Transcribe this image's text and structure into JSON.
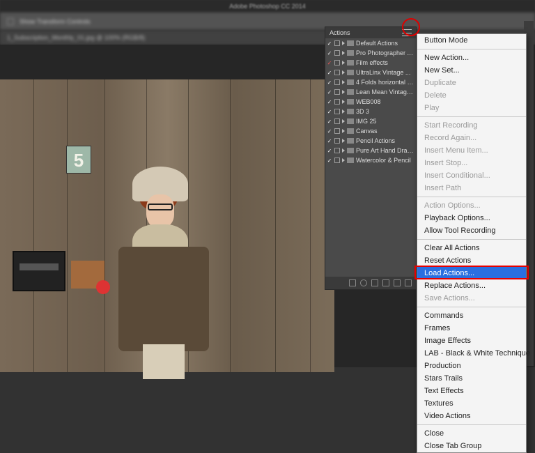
{
  "app": {
    "title": "Adobe Photoshop CC 2014"
  },
  "options_bar": {
    "show_transform_label": "Show Transform Controls"
  },
  "document_tab": {
    "label": "1_Subscription_Monthly_01.jpg @ 100% (RGB/8)"
  },
  "canvas": {
    "plate_number": "5"
  },
  "actions_panel": {
    "title": "Actions",
    "sets": [
      {
        "name": "Default Actions",
        "checked": true
      },
      {
        "name": "Pro Photographer A...",
        "checked": true
      },
      {
        "name": "Film effects",
        "checked": true,
        "redcheck": true
      },
      {
        "name": "UltraLinx Vintage ...",
        "checked": true
      },
      {
        "name": "4 Folds horizontal v...",
        "checked": true
      },
      {
        "name": "Lean Mean Vintage ...",
        "checked": true
      },
      {
        "name": "WEB008",
        "checked": true
      },
      {
        "name": "3D 3",
        "checked": true
      },
      {
        "name": "IMG 25",
        "checked": true
      },
      {
        "name": "Canvas",
        "checked": true
      },
      {
        "name": "Pencil Actions",
        "checked": true
      },
      {
        "name": "Pure Art Hand Draw...",
        "checked": true
      },
      {
        "name": "Watercolor & Pencil",
        "checked": true
      }
    ],
    "footer_icons": [
      "stop-icon",
      "record-icon",
      "play-icon",
      "new-set-icon",
      "new-action-icon",
      "trash-icon"
    ]
  },
  "flyout_menu": {
    "groups": [
      [
        {
          "label": "Button Mode",
          "enabled": true
        }
      ],
      [
        {
          "label": "New Action...",
          "enabled": true
        },
        {
          "label": "New Set...",
          "enabled": true
        },
        {
          "label": "Duplicate",
          "enabled": false
        },
        {
          "label": "Delete",
          "enabled": false
        },
        {
          "label": "Play",
          "enabled": false
        }
      ],
      [
        {
          "label": "Start Recording",
          "enabled": false
        },
        {
          "label": "Record Again...",
          "enabled": false
        },
        {
          "label": "Insert Menu Item...",
          "enabled": false
        },
        {
          "label": "Insert Stop...",
          "enabled": false
        },
        {
          "label": "Insert Conditional...",
          "enabled": false
        },
        {
          "label": "Insert Path",
          "enabled": false
        }
      ],
      [
        {
          "label": "Action Options...",
          "enabled": false
        },
        {
          "label": "Playback Options...",
          "enabled": true
        },
        {
          "label": "Allow Tool Recording",
          "enabled": true
        }
      ],
      [
        {
          "label": "Clear All Actions",
          "enabled": true
        },
        {
          "label": "Reset Actions",
          "enabled": true
        },
        {
          "label": "Load Actions...",
          "enabled": true,
          "highlighted": true
        },
        {
          "label": "Replace Actions...",
          "enabled": true
        },
        {
          "label": "Save Actions...",
          "enabled": false
        }
      ],
      [
        {
          "label": "Commands",
          "enabled": true
        },
        {
          "label": "Frames",
          "enabled": true
        },
        {
          "label": "Image Effects",
          "enabled": true
        },
        {
          "label": "LAB - Black & White Technique",
          "enabled": true
        },
        {
          "label": "Production",
          "enabled": true
        },
        {
          "label": "Stars Trails",
          "enabled": true
        },
        {
          "label": "Text Effects",
          "enabled": true
        },
        {
          "label": "Textures",
          "enabled": true
        },
        {
          "label": "Video Actions",
          "enabled": true
        }
      ],
      [
        {
          "label": "Close",
          "enabled": true
        },
        {
          "label": "Close Tab Group",
          "enabled": true
        }
      ]
    ]
  },
  "annotations": {
    "circle_target": "panel-menu-icon",
    "box_target": "Load Actions..."
  }
}
